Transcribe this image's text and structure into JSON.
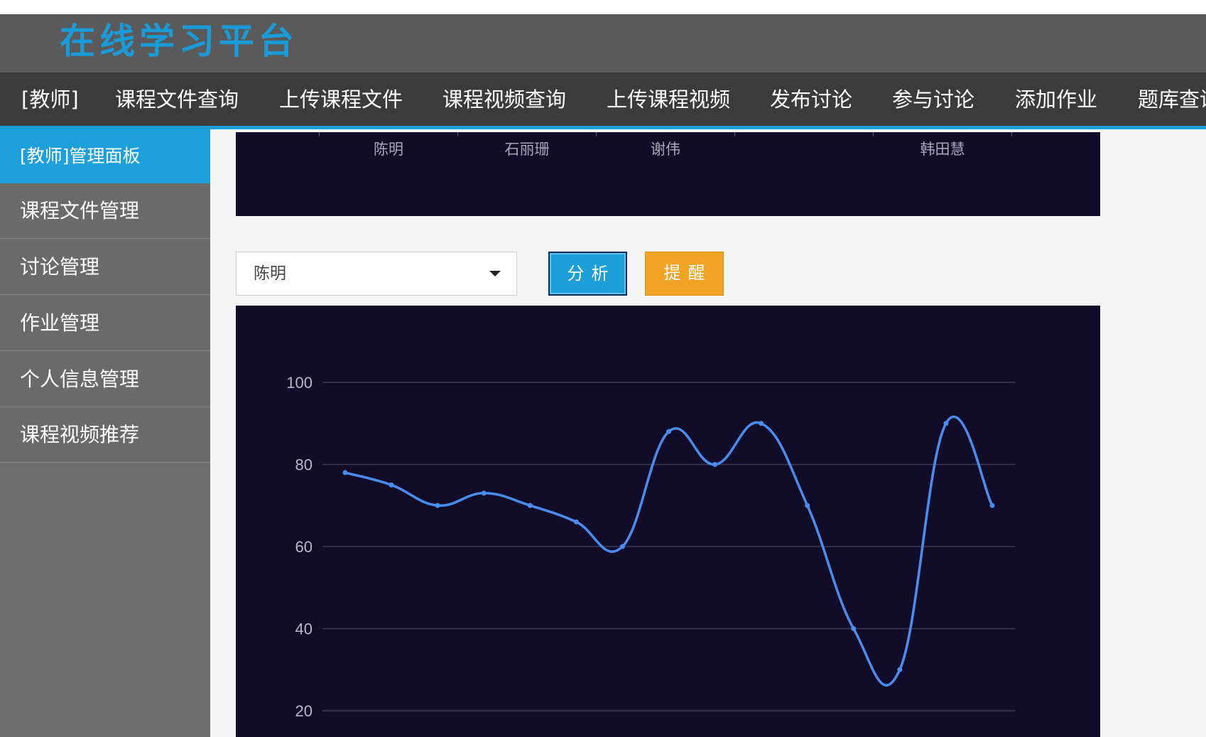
{
  "header": {
    "site_title": "在线学习平台"
  },
  "nav": {
    "items": [
      "[教师]",
      "课程文件查询",
      "上传课程文件",
      "课程视频查询",
      "上传课程视频",
      "发布讨论",
      "参与讨论",
      "添加作业",
      "题库查询"
    ]
  },
  "sidebar": {
    "items": [
      {
        "label": "[教师]管理面板",
        "active": true
      },
      {
        "label": "课程文件管理",
        "active": false
      },
      {
        "label": "讨论管理",
        "active": false
      },
      {
        "label": "作业管理",
        "active": false
      },
      {
        "label": "个人信息管理",
        "active": false
      },
      {
        "label": "课程视频推荐",
        "active": false
      }
    ]
  },
  "top_chart": {
    "x_labels": [
      "",
      "陈明",
      "石丽珊",
      "谢伟",
      "",
      "韩田慧"
    ]
  },
  "controls": {
    "student_select": {
      "value": "陈明"
    },
    "analyze_label": "分析",
    "remind_label": "提醒"
  },
  "colors": {
    "brand": "#1c9fd9",
    "header_bg": "#5a5a5a",
    "nav_bg": "#3b3b3b",
    "sidebar_bg": "#6a6a6a",
    "chart_bg": "#110d28",
    "line": "#4a8df0",
    "remind": "#f0a325"
  },
  "chart_data": {
    "type": "line",
    "y_ticks": [
      100,
      80,
      60,
      40,
      20
    ],
    "ylim": [
      20,
      100
    ],
    "grid": true,
    "smooth": true,
    "series": [
      {
        "values": [
          78,
          75,
          70,
          73,
          70,
          66,
          60,
          88,
          80,
          90,
          70,
          40,
          30,
          90,
          70
        ]
      }
    ]
  }
}
